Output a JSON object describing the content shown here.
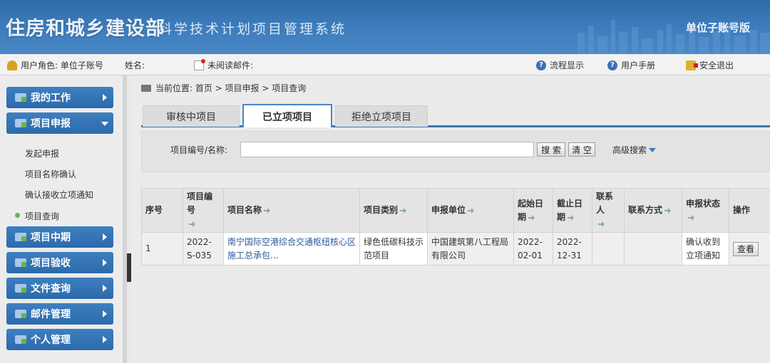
{
  "header": {
    "title": "住房和城乡建设部",
    "subtitle": "科学技术计划项目管理系统",
    "edition": "单位子账号版"
  },
  "infobar": {
    "role": "用户角色: 单位子账号",
    "name_label": "姓名:",
    "mail_label": "未阅读邮件:",
    "flow": "流程显示",
    "manual": "用户手册",
    "logout": "安全退出"
  },
  "sidebar": {
    "items": [
      {
        "label": "我的工作"
      },
      {
        "label": "项目申报"
      },
      {
        "label": "项目中期"
      },
      {
        "label": "项目验收"
      },
      {
        "label": "文件查询"
      },
      {
        "label": "邮件管理"
      },
      {
        "label": "个人管理"
      }
    ],
    "subitems": [
      {
        "label": "发起申报"
      },
      {
        "label": "项目名称确认"
      },
      {
        "label": "确认接收立项通知"
      },
      {
        "label": "项目查询"
      }
    ]
  },
  "breadcrumb": "当前位置: 首页 > 项目申报 > 项目查询",
  "tabs": [
    {
      "label": "审核中项目"
    },
    {
      "label": "已立项项目"
    },
    {
      "label": "拒绝立项项目"
    }
  ],
  "search": {
    "label": "项目编号/名称:",
    "value": "",
    "search_btn": "搜 索",
    "clear_btn": "清 空",
    "advanced": "高级搜索"
  },
  "table": {
    "columns": [
      "序号",
      "项目编号",
      "项目名称",
      "项目类别",
      "申报单位",
      "起始日期",
      "截止日期",
      "联系人",
      "联系方式",
      "申报状态",
      "操作"
    ],
    "rows": [
      {
        "index": "1",
        "code": "2022-S-035",
        "name": "南宁国际空港综合交通枢纽核心区施工总承包...",
        "category": "绿色低碳科技示范项目",
        "unit": "中国建筑第八工程局有限公司",
        "start": "2022-02-01",
        "end": "2022-12-31",
        "contact": "",
        "phone": "",
        "status": "确认收到立项通知",
        "action": "查看"
      }
    ]
  },
  "colors": {
    "banner": "#3c7bbb",
    "menu": "#2b6aac",
    "tab_border": "#3c78b4",
    "link": "#2a5a9a"
  }
}
